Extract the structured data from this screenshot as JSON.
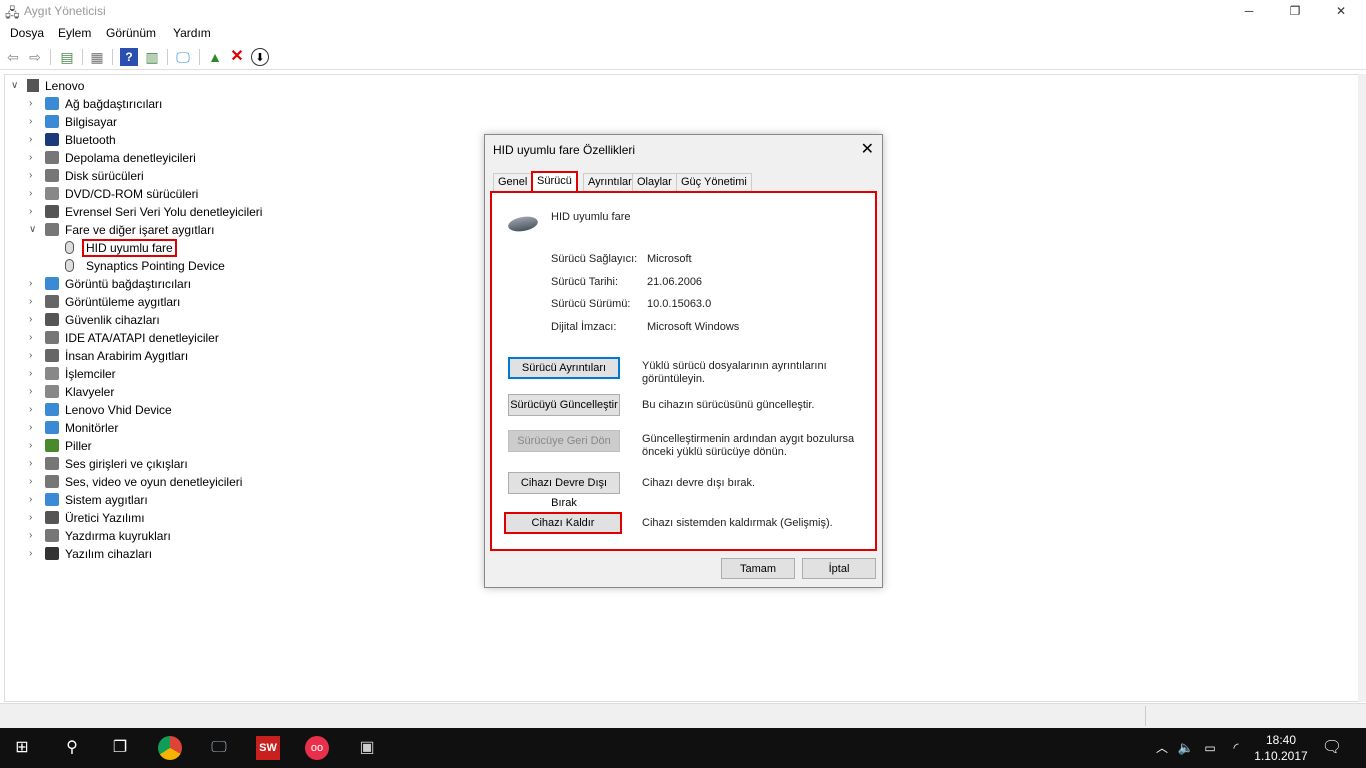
{
  "window": {
    "title": "Aygıt Yöneticisi",
    "minimize": "─",
    "maximize": "❐",
    "close": "✕"
  },
  "menu": [
    "Dosya",
    "Eylem",
    "Görünüm",
    "Yardım"
  ],
  "tree": {
    "root": "Lenovo",
    "items": [
      {
        "label": "Ağ bağdaştırıcıları",
        "icon": "network-adapter-icon",
        "color": "#3a8ad6"
      },
      {
        "label": "Bilgisayar",
        "icon": "computer-icon",
        "color": "#3a8ad6"
      },
      {
        "label": "Bluetooth",
        "icon": "bluetooth-icon",
        "color": "#1a3a7a"
      },
      {
        "label": "Depolama denetleyicileri",
        "icon": "storage-controller-icon",
        "color": "#777"
      },
      {
        "label": "Disk sürücüleri",
        "icon": "disk-drive-icon",
        "color": "#777"
      },
      {
        "label": "DVD/CD-ROM sürücüleri",
        "icon": "dvd-icon",
        "color": "#888"
      },
      {
        "label": "Evrensel Seri Veri Yolu denetleyicileri",
        "icon": "usb-icon",
        "color": "#555"
      },
      {
        "label": "Fare ve diğer işaret aygıtları",
        "icon": "mouse-icon",
        "color": "#777",
        "expanded": true,
        "children": [
          {
            "label": "HID uyumlu fare",
            "highlighted": true
          },
          {
            "label": "Synaptics Pointing Device"
          }
        ]
      },
      {
        "label": "Görüntü bağdaştırıcıları",
        "icon": "display-adapter-icon",
        "color": "#3a8ad6"
      },
      {
        "label": "Görüntüleme aygıtları",
        "icon": "imaging-icon",
        "color": "#666"
      },
      {
        "label": "Güvenlik cihazları",
        "icon": "security-icon",
        "color": "#555"
      },
      {
        "label": "IDE ATA/ATAPI denetleyiciler",
        "icon": "ide-icon",
        "color": "#777"
      },
      {
        "label": "İnsan Arabirim Aygıtları",
        "icon": "hid-icon",
        "color": "#666"
      },
      {
        "label": "İşlemciler",
        "icon": "processor-icon",
        "color": "#888"
      },
      {
        "label": "Klavyeler",
        "icon": "keyboard-icon",
        "color": "#888"
      },
      {
        "label": "Lenovo Vhid Device",
        "icon": "device-icon",
        "color": "#3a8ad6"
      },
      {
        "label": "Monitörler",
        "icon": "monitor-icon",
        "color": "#3a8ad6"
      },
      {
        "label": "Piller",
        "icon": "battery-icon",
        "color": "#4a8a2a"
      },
      {
        "label": "Ses girişleri ve çıkışları",
        "icon": "audio-icon",
        "color": "#777"
      },
      {
        "label": "Ses, video ve oyun denetleyicileri",
        "icon": "sound-icon",
        "color": "#777"
      },
      {
        "label": "Sistem aygıtları",
        "icon": "system-icon",
        "color": "#3a8ad6"
      },
      {
        "label": "Üretici Yazılımı",
        "icon": "firmware-icon",
        "color": "#555"
      },
      {
        "label": "Yazdırma kuyrukları",
        "icon": "printer-icon",
        "color": "#777"
      },
      {
        "label": "Yazılım cihazları",
        "icon": "software-device-icon",
        "color": "#333"
      }
    ]
  },
  "dialog": {
    "title": "HID uyumlu fare Özellikleri",
    "tabs": [
      "Genel",
      "Sürücü",
      "Ayrıntılar",
      "Olaylar",
      "Güç Yönetimi"
    ],
    "device_name": "HID uyumlu fare",
    "info": [
      {
        "label": "Sürücü Sağlayıcı:",
        "value": "Microsoft"
      },
      {
        "label": "Sürücü Tarihi:",
        "value": "21.06.2006"
      },
      {
        "label": "Sürücü Sürümü:",
        "value": "10.0.15063.0"
      },
      {
        "label": "Dijital İmzacı:",
        "value": "Microsoft Windows"
      }
    ],
    "actions": [
      {
        "button": "Sürücü Ayrıntıları",
        "desc": "Yüklü sürücü dosyalarının ayrıntılarını görüntüleyin."
      },
      {
        "button": "Sürücüyü Güncelleştir",
        "desc": "Bu cihazın sürücüsünü güncelleştir."
      },
      {
        "button": "Sürücüye Geri Dön",
        "desc": "Güncelleştirmenin ardından aygıt bozulursa önceki yüklü sürücüye dönün."
      },
      {
        "button": "Cihazı Devre Dışı Bırak",
        "desc": "Cihazı devre dışı bırak."
      },
      {
        "button": "Cihazı Kaldır",
        "desc": "Cihazı sistemden kaldırmak (Gelişmiş)."
      }
    ],
    "ok": "Tamam",
    "cancel": "İptal"
  },
  "taskbar": {
    "time": "18:40",
    "date": "1.10.2017"
  },
  "colors": {
    "highlight": "#e00000",
    "taskbar": "#101010",
    "focus": "#0078d7"
  }
}
